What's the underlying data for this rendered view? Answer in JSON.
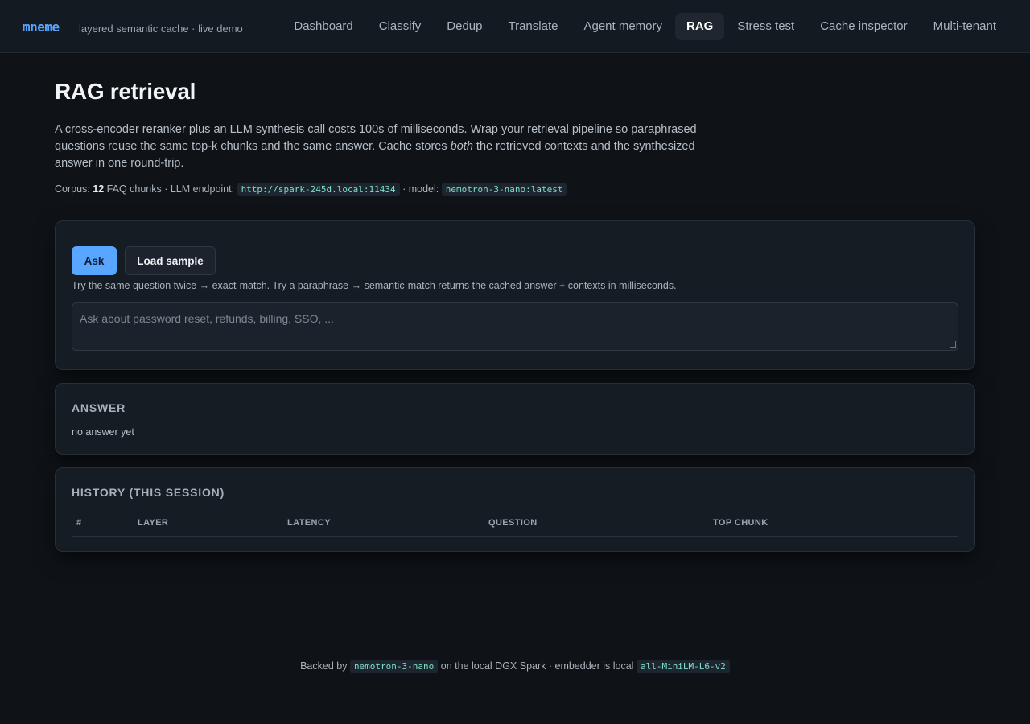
{
  "app": {
    "brand": "mneme",
    "tagline": "layered semantic cache · live demo"
  },
  "nav": {
    "items": [
      "Dashboard",
      "Classify",
      "Dedup",
      "Translate",
      "Agent memory",
      "RAG",
      "Stress test",
      "Cache inspector",
      "Multi-tenant"
    ],
    "active": "RAG"
  },
  "page": {
    "title": "RAG retrieval",
    "intro_before": "A cross-encoder reranker plus an LLM synthesis call costs 100s of milliseconds. Wrap your retrieval pipeline so paraphrased questions reuse the same top-k chunks and the same answer. Cache stores ",
    "intro_emphasis": "both",
    "intro_after": " the retrieved contexts and the synthesized answer in one round-trip.",
    "meta": {
      "corpus_label": "Corpus:",
      "corpus_count": "12",
      "corpus_unit": "FAQ chunks · LLM endpoint:",
      "endpoint": "http://spark-245d.local:11434",
      "model_label": "· model:",
      "model": "nemotron-3-nano:latest"
    }
  },
  "ask": {
    "ask_label": "Ask",
    "sample_label": "Load sample",
    "hint": "Try the same question twice → exact-match. Try a paraphrase → semantic-match returns the cached answer + contexts in milliseconds.",
    "placeholder": "Ask about password reset, refunds, billing, SSO, ..."
  },
  "answer": {
    "title": "ANSWER",
    "empty": "no answer yet"
  },
  "history": {
    "title": "HISTORY (THIS SESSION)",
    "columns": [
      "#",
      "LAYER",
      "LATENCY",
      "QUESTION",
      "TOP CHUNK"
    ],
    "rows": []
  },
  "footer": {
    "prefix": "Backed by",
    "llm": "nemotron-3-nano",
    "middle": "on the local DGX Spark · embedder is local",
    "embedder": "all-MiniLM-L6-v2"
  },
  "colors": {
    "accent": "#58a6ff",
    "code_text": "#7ee0c2",
    "background": "#0f1318"
  }
}
